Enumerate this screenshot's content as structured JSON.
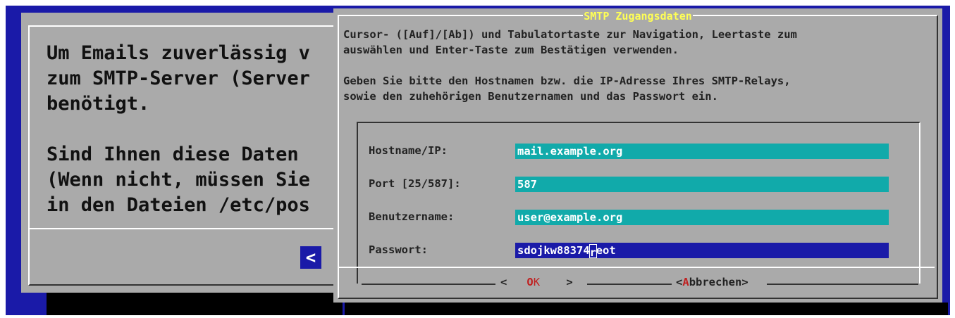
{
  "back_dialog": {
    "lines": [
      "Um Emails zuverlässig v",
      "zum SMTP-Server (Server",
      "benötigt.",
      "",
      "Sind Ihnen diese Daten",
      "(Wenn nicht, müssen Sie",
      "in den Dateien /etc/pos"
    ],
    "button_label": "<"
  },
  "front_dialog": {
    "title": "SMTP Zugangsdaten",
    "instructions": "Cursor- ([Auf]/[Ab]) und Tabulatortaste zur Navigation, Leertaste zum\nauswählen und Enter-Taste zum Bestätigen verwenden.\n\nGeben Sie bitte den Hostnamen bzw. die IP-Adresse Ihres SMTP-Relays,\nsowie den zuhehörigen Benutzernamen und das Passwort ein.",
    "fields": [
      {
        "label": "Hostname/IP:",
        "value": "mail.example.org"
      },
      {
        "label": "Port [25/587]:",
        "value": "587"
      },
      {
        "label": "Benutzername:",
        "value": "user@example.org"
      },
      {
        "label": "Passwort:",
        "value_before": "sdojkw88374",
        "value_cursor": "r",
        "value_after": "eot"
      }
    ],
    "ok_button": {
      "left": "<",
      "hotkey": "O",
      "rest": "K",
      "right": ">"
    },
    "cancel_button": {
      "left": "<",
      "hotkey": "A",
      "rest": "bbrechen",
      "right": ">"
    }
  }
}
